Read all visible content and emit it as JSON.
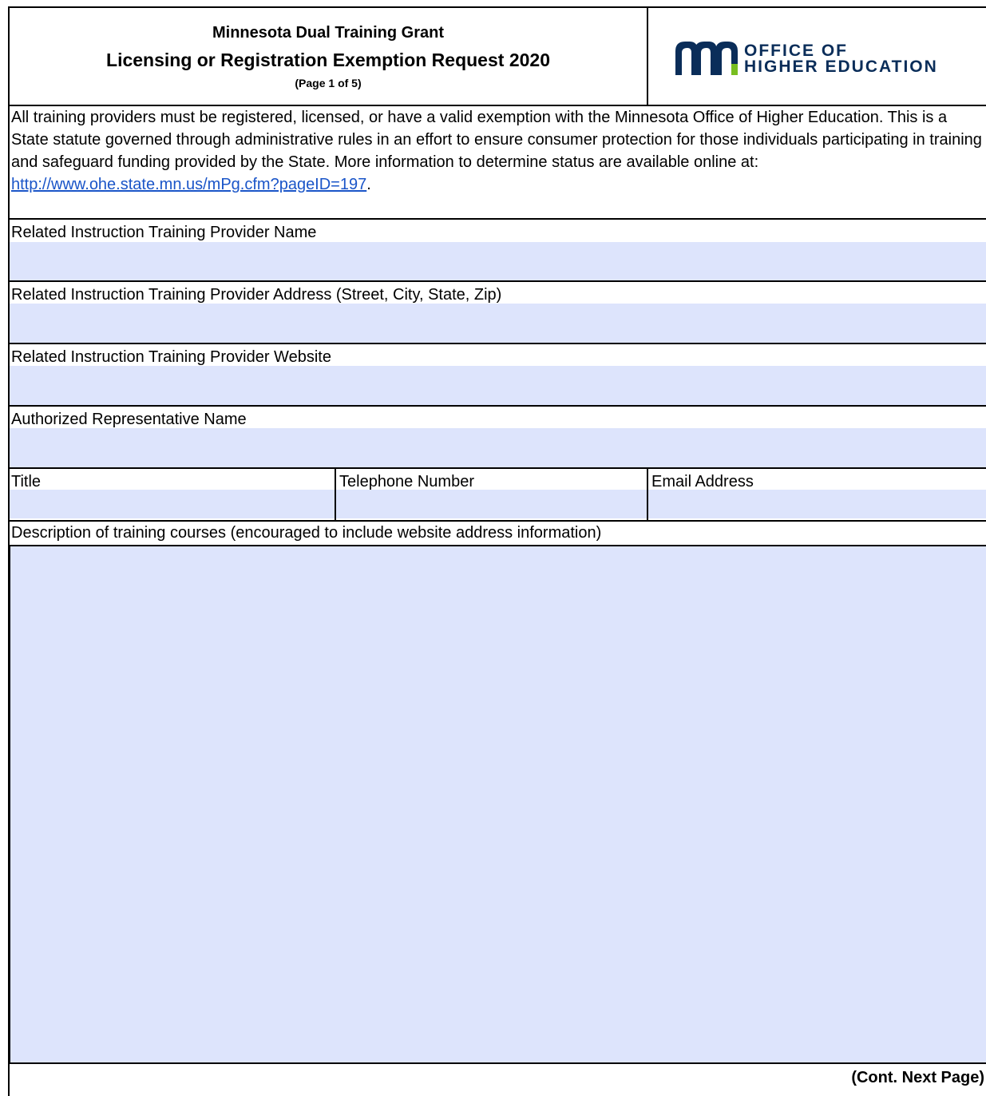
{
  "header": {
    "line1": "Minnesota Dual Training Grant",
    "line2": "Licensing or Registration Exemption Request 2020",
    "line3": "(Page 1 of 5)"
  },
  "logo": {
    "mark": "mn",
    "line1": "OFFICE OF",
    "line2": "HIGHER EDUCATION",
    "icon": "minnesota-logo-icon",
    "color": "#0a2d59",
    "accent": "#78be20"
  },
  "intro": {
    "text": "All training providers must be registered, licensed, or have a valid exemption with the Minnesota Office of Higher Education. This is a State statute governed through administrative rules in an effort to ensure consumer protection for those individuals participating in training and safeguard funding provided by the State. More information to determine status are available online at: ",
    "link": "http://www.ohe.state.mn.us/mPg.cfm?pageID=197",
    "after_link": "."
  },
  "fields": {
    "provider_name": {
      "label": "Related Instruction Training Provider Name",
      "value": ""
    },
    "provider_address": {
      "label": "Related Instruction Training Provider Address (Street, City, State, Zip)",
      "value": ""
    },
    "provider_website": {
      "label": "Related Instruction Training Provider Website",
      "value": ""
    },
    "rep_name": {
      "label": "Authorized Representative Name",
      "value": ""
    },
    "title": {
      "label": "Title",
      "value": ""
    },
    "telephone": {
      "label": "Telephone Number",
      "value": ""
    },
    "email": {
      "label": "Email Address",
      "value": ""
    },
    "description": {
      "label": "Description of training courses (encouraged to include website address information)",
      "value": ""
    }
  },
  "footer": {
    "continued": "(Cont. Next Page)"
  },
  "colors": {
    "field_fill": "#dde4fc",
    "link": "#1a55c8"
  }
}
